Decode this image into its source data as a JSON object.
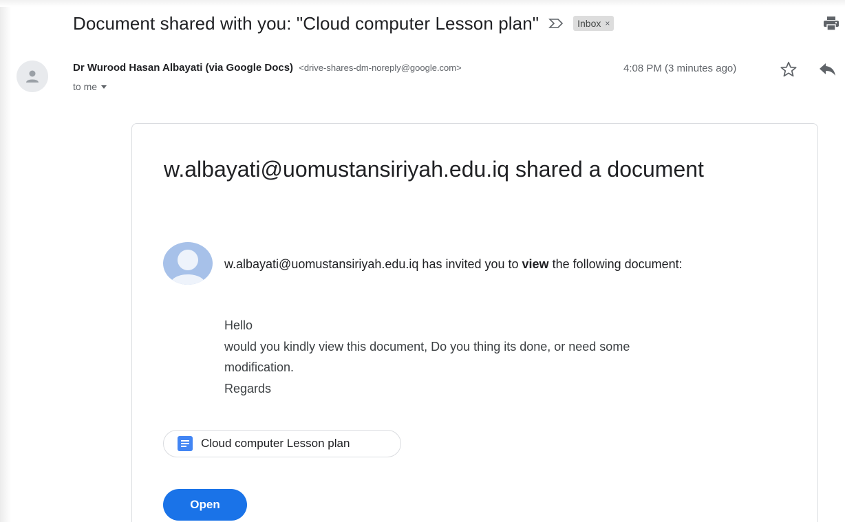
{
  "email": {
    "subject": "Document shared with you: \"Cloud computer Lesson plan\"",
    "label_chip": {
      "label": "Inbox",
      "remove": "×"
    },
    "sender": {
      "name": "Dr Wurood Hasan Albayati (via Google Docs)",
      "email": "<drive-shares-dm-noreply@google.com>"
    },
    "recipient_summary": "to me",
    "timestamp": "4:08 PM (3 minutes ago)",
    "icons": {
      "importance": "importance-marker-icon",
      "print": "print-icon",
      "avatar": "person-icon",
      "star": "star-icon",
      "reply": "reply-icon",
      "dropdown": "chevron-down-icon"
    }
  },
  "share_card": {
    "title": "w.albayati@uomustansiriyah.edu.iq shared a document",
    "invite": {
      "prefix": "w.albayati@uomustansiriyah.edu.iq has invited you to ",
      "emphasis": "view",
      "suffix": " the following document:"
    },
    "message_lines": [
      "Hello",
      "would you kindly view this document, Do you thing its done, or need some",
      "modification.",
      "Regards"
    ],
    "document_chip": {
      "label": "Cloud computer Lesson plan",
      "icon": "google-docs-icon"
    },
    "open_button": "Open"
  },
  "colors": {
    "accent": "#1a73e8",
    "docs_blue": "#4285f4",
    "avatar_bg": "#a7c1e9",
    "text_primary": "#202124",
    "text_secondary": "#5f6368"
  }
}
